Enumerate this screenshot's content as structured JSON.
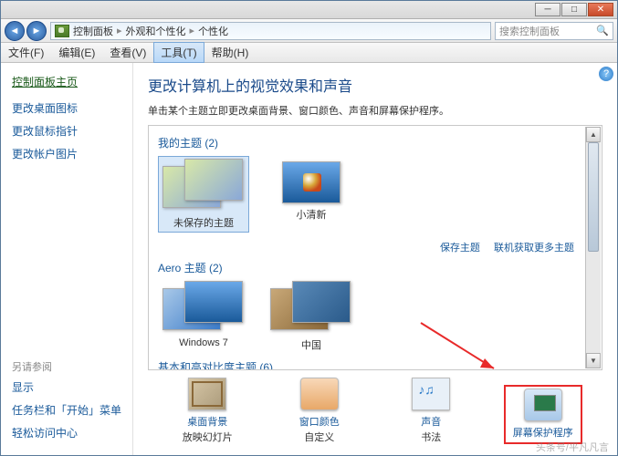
{
  "breadcrumb": {
    "seg1": "控制面板",
    "seg2": "外观和个性化",
    "seg3": "个性化"
  },
  "search": {
    "placeholder": "搜索控制面板"
  },
  "menu": {
    "file": "文件(F)",
    "edit": "编辑(E)",
    "view": "查看(V)",
    "tools": "工具(T)",
    "help": "帮助(H)"
  },
  "sidebar": {
    "home": "控制面板主页",
    "links": [
      "更改桌面图标",
      "更改鼠标指针",
      "更改帐户图片"
    ],
    "see_also": "另请参阅",
    "extras": [
      "显示",
      "任务栏和「开始」菜单",
      "轻松访问中心"
    ]
  },
  "main": {
    "title": "更改计算机上的视觉效果和声音",
    "desc": "单击某个主题立即更改桌面背景、窗口颜色、声音和屏幕保护程序。"
  },
  "panel": {
    "my_themes_h": "我的主题 (2)",
    "my_themes": [
      {
        "label": "未保存的主题"
      },
      {
        "label": "小清新"
      }
    ],
    "save_link": "保存主题",
    "more_link": "联机获取更多主题",
    "aero_h": "Aero 主题 (2)",
    "aero_themes": [
      {
        "label": "Windows 7"
      },
      {
        "label": "中国"
      }
    ],
    "basic_h": "基本和高对比度主题 (6)"
  },
  "bottom": [
    {
      "label": "桌面背景",
      "sub": "放映幻灯片"
    },
    {
      "label": "窗口颜色",
      "sub": "自定义"
    },
    {
      "label": "声音",
      "sub": "书法"
    },
    {
      "label": "屏幕保护程序",
      "sub": ""
    }
  ],
  "watermark": "头条号/平凡凡言"
}
